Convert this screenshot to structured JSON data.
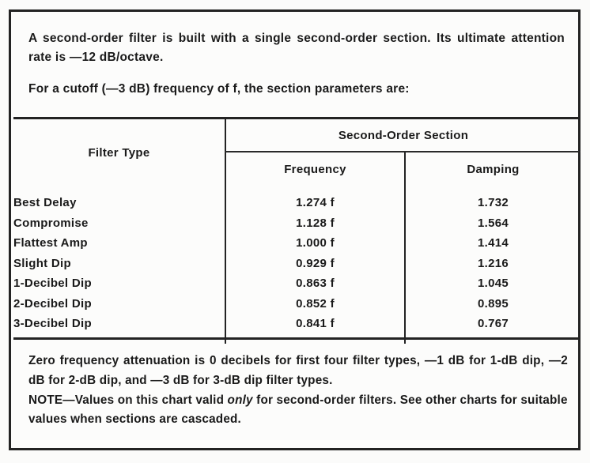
{
  "document": {
    "intro": {
      "paragraph_1": "A second-order filter is built with a single second-order section. Its ultimate attention rate is —12 dB/octave.",
      "paragraph_2": "For a cutoff (—3 dB) frequency of f, the section parameters are:"
    },
    "table": {
      "group_header": "Second-Order  Section",
      "columns": {
        "filter_type": "Filter  Type",
        "frequency": "Frequency",
        "damping": "Damping"
      },
      "rows": [
        {
          "filter_type": "Best  Delay",
          "frequency": "1.274 f",
          "damping": "1.732"
        },
        {
          "filter_type": "Compromise",
          "frequency": "1.128 f",
          "damping": "1.564"
        },
        {
          "filter_type": "Flattest Amp",
          "frequency": "1.000 f",
          "damping": "1.414"
        },
        {
          "filter_type": "Slight  Dip",
          "frequency": "0.929 f",
          "damping": "1.216"
        },
        {
          "filter_type": "1-Decibel  Dip",
          "frequency": "0.863 f",
          "damping": "1.045"
        },
        {
          "filter_type": "2-Decibel  Dip",
          "frequency": "0.852 f",
          "damping": "0.895"
        },
        {
          "filter_type": "3-Decibel  Dip",
          "frequency": "0.841 f",
          "damping": "0.767"
        }
      ]
    },
    "footer": {
      "note_1": "Zero frequency attenuation is 0 decibels for first four filter types, —1 dB for 1-dB dip, —2 dB for 2-dB dip, and —3 dB for 3-dB dip filter types.",
      "note_2_prefix": "NOTE—Values on this chart valid ",
      "note_2_emphasis": "only",
      "note_2_suffix": " for second-order filters. See other charts for suitable values when sections are cascaded."
    },
    "colors": {
      "ink": "#1a1a1a",
      "rule": "#232323",
      "paper": "#fbfbfa"
    }
  },
  "chart_data": {
    "type": "table",
    "title": "Second-Order Section filter parameters",
    "categories": [
      "Best Delay",
      "Compromise",
      "Flattest Amp",
      "Slight Dip",
      "1-Decibel Dip",
      "2-Decibel Dip",
      "3-Decibel Dip"
    ],
    "series": [
      {
        "name": "Frequency (×f)",
        "values": [
          1.274,
          1.128,
          1.0,
          0.929,
          0.863,
          0.852,
          0.841
        ]
      },
      {
        "name": "Damping",
        "values": [
          1.732,
          1.564,
          1.414,
          1.216,
          1.045,
          0.895,
          0.767
        ]
      }
    ],
    "xlabel": "Filter Type",
    "ylabel": "",
    "legend": "none",
    "grid": true
  }
}
